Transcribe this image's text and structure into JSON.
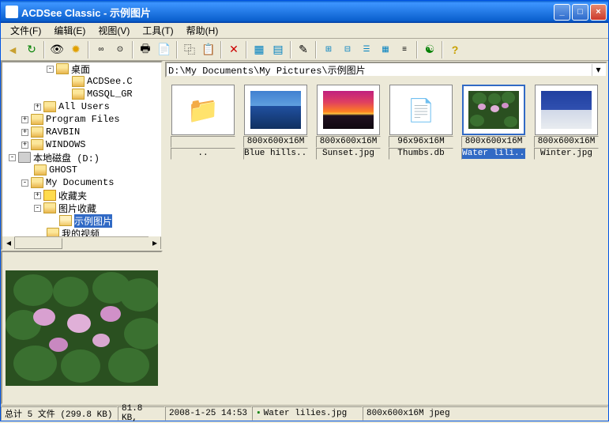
{
  "window": {
    "title": "ACDSee Classic - 示例图片"
  },
  "menu": {
    "file": "文件(F)",
    "edit": "编辑(E)",
    "view": "视图(V)",
    "tools": "工具(T)",
    "help": "帮助(H)"
  },
  "path": "D:\\My Documents\\My Pictures\\示例图片",
  "tree": {
    "desktop": "桌面",
    "acdsee": "ACDSee.C",
    "mgsql": "MGSQL_GR",
    "allusers": "All Users",
    "progfiles": "Program Files",
    "ravbin": "RAVBIN",
    "windows": "WINDOWS",
    "localdisk": "本地磁盘 (D:)",
    "ghost": "GHOST",
    "mydocs": "My Documents",
    "favorites": "收藏夹",
    "pictures": "图片收藏",
    "samples": "示例图片",
    "videos": "我的视频"
  },
  "thumbs": [
    {
      "info": "",
      "name": ".."
    },
    {
      "info": "800x600x16M",
      "name": "Blue hills..."
    },
    {
      "info": "800x600x16M",
      "name": "Sunset.jpg"
    },
    {
      "info": "96x96x16M",
      "name": "Thumbs.db"
    },
    {
      "info": "800x600x16M",
      "name": "Water lili..."
    },
    {
      "info": "800x600x16M",
      "name": "Winter.jpg"
    }
  ],
  "status": {
    "total": "总计 5 文件 (299.8 KB)",
    "size": "81.8 KB,",
    "date": "2008-1-25 14:53",
    "filename": "Water lilies.jpg",
    "dims": "800x600x16M jpeg"
  }
}
